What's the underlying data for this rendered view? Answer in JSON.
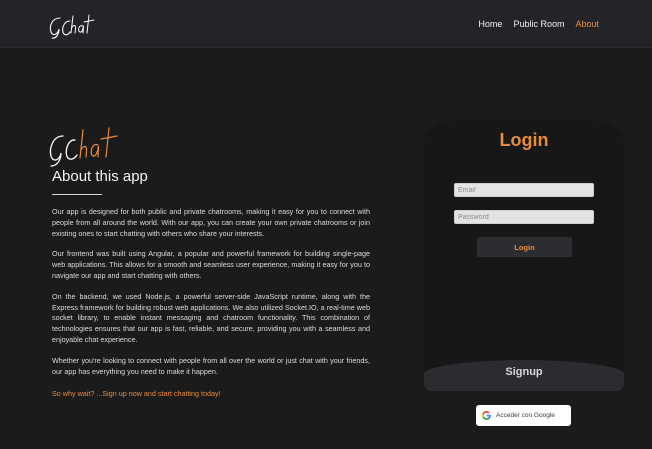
{
  "navbar": {
    "brand_logo": "GChat",
    "links": [
      {
        "label": "Home",
        "active": false
      },
      {
        "label": "Public Room",
        "active": false
      },
      {
        "label": "About",
        "active": true
      }
    ]
  },
  "about": {
    "logo": "GChat",
    "title": "About this app",
    "paragraphs": [
      "Our app is designed for both public and private chatrooms, making it easy for you to connect with people from all around the world. With our app, you can create your own private chatrooms or join existing ones to start chatting with others who share your interests.",
      "Our frontend was built using Angular, a popular and powerful framework for building single-page web applications. This allows for a smooth and seamless user experience, making it easy for you to navigate our app and start chatting with others.",
      "On the backend, we used Node.js, a powerful server-side JavaScript runtime, along with the Express framework for building robust web applications. We also utilized Socket.IO, a real-time web socket library, to enable instant messaging and chatroom functionality. This combination of technologies ensures that our app is fast, reliable, and secure, providing you with a seamless and enjoyable chat experience.",
      "Whether you're looking to connect with people from all over the world or just chat with your friends, our app has everything you need to make it happen."
    ],
    "cta": "So why wait? ...Sign up now and start chatting today!"
  },
  "login": {
    "title": "Login",
    "email_placeholder": "Email",
    "email_value": "",
    "password_placeholder": "Password",
    "password_value": "",
    "login_button": "Login",
    "signup_label": "Signup"
  },
  "google": {
    "icon": "google-g-icon",
    "label": "Acceder con Google"
  },
  "colors": {
    "background": "#1b1b1c",
    "navbar": "#232427",
    "accent": "#e98b3c",
    "card": "#171718",
    "signup_panel": "#2b2c30"
  }
}
